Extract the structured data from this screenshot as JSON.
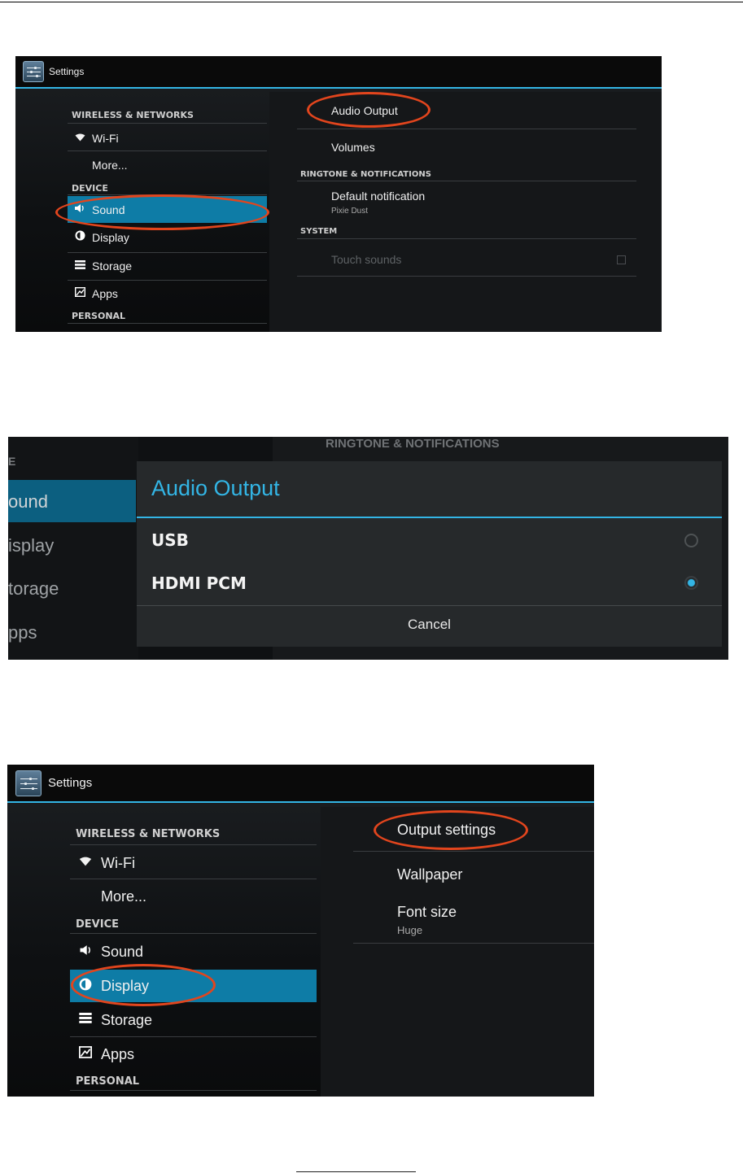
{
  "shot1": {
    "title": "Settings",
    "left": {
      "sec_wireless": "WIRELESS & NETWORKS",
      "wifi": "Wi-Fi",
      "more": "More...",
      "sec_device": "DEVICE",
      "sound": "Sound",
      "display": "Display",
      "storage": "Storage",
      "apps": "Apps",
      "sec_personal": "PERSONAL"
    },
    "right": {
      "audio_output": "Audio Output",
      "volumes": "Volumes",
      "sec_ringtone": "RINGTONE & NOTIFICATIONS",
      "default_notification": "Default notification",
      "default_notification_value": "Pixie Dust",
      "sec_system": "SYSTEM",
      "touch_sounds": "Touch sounds"
    },
    "selected": "Sound"
  },
  "shot2": {
    "bg_left": [
      "ound",
      "isplay",
      "torage",
      "pps"
    ],
    "bg_header": "RINGTONE & NOTIFICATIONS",
    "bg_e": "E",
    "dialog_title": "Audio Output",
    "options": [
      {
        "label": "USB",
        "checked": false
      },
      {
        "label": "HDMI PCM",
        "checked": true
      }
    ],
    "cancel": "Cancel"
  },
  "shot3": {
    "title": "Settings",
    "left": {
      "sec_wireless": "WIRELESS & NETWORKS",
      "wifi": "Wi-Fi",
      "more": "More...",
      "sec_device": "DEVICE",
      "sound": "Sound",
      "display": "Display",
      "storage": "Storage",
      "apps": "Apps",
      "sec_personal": "PERSONAL"
    },
    "right": {
      "output_settings": "Output settings",
      "wallpaper": "Wallpaper",
      "font_size": "Font size",
      "font_size_value": "Huge"
    },
    "selected": "Display"
  },
  "colors": {
    "accent": "#33b5e5",
    "selected": "#0e7ca6",
    "highlight_oval": "#e2451d"
  },
  "icons": [
    "settings-app-icon",
    "wifi-icon",
    "sound-icon",
    "display-icon",
    "storage-icon",
    "apps-icon"
  ]
}
